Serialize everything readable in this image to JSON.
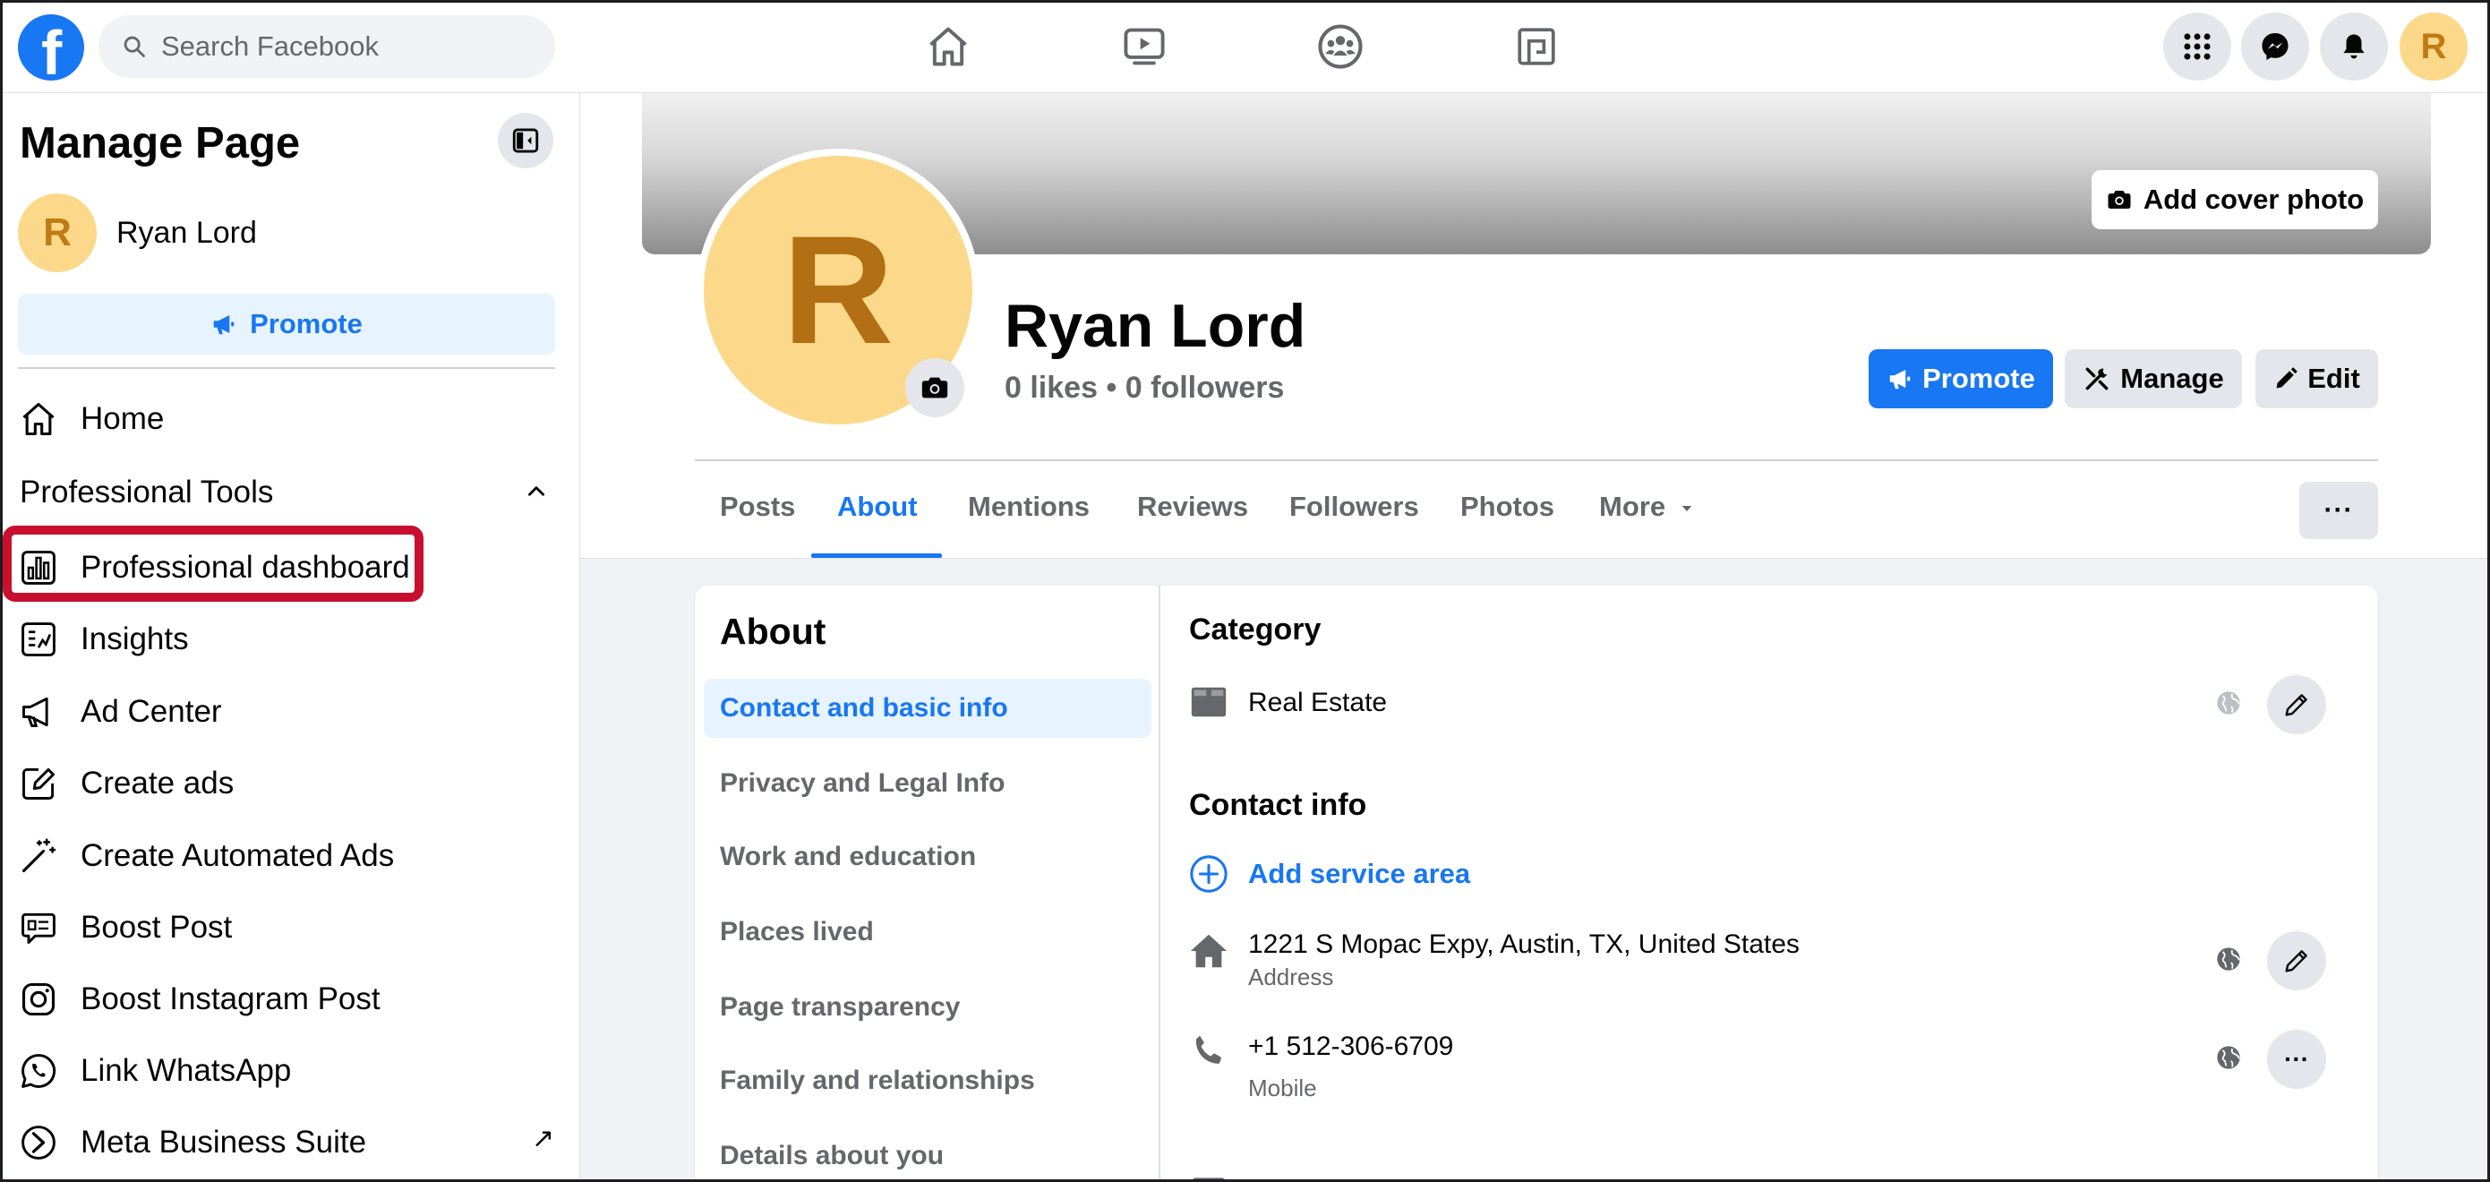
{
  "topbar": {
    "logo_letter": "f",
    "search_placeholder": "Search Facebook",
    "nav_icons": [
      "home-icon",
      "watch-icon",
      "groups-icon",
      "gaming-icon"
    ],
    "right_icons": [
      "menu-grid-icon",
      "messenger-icon",
      "notifications-icon"
    ],
    "avatar_letter": "R"
  },
  "sidebar": {
    "title": "Manage Page",
    "user_initial": "R",
    "user_name": "Ryan Lord",
    "promote_label": "Promote",
    "home_label": "Home",
    "section_label": "Professional Tools",
    "items": [
      {
        "label": "Professional dashboard",
        "icon": "dashboard-icon"
      },
      {
        "label": "Insights",
        "icon": "insights-icon"
      },
      {
        "label": "Ad Center",
        "icon": "megaphone-icon"
      },
      {
        "label": "Create ads",
        "icon": "edit-square-icon"
      },
      {
        "label": "Create Automated Ads",
        "icon": "magic-wand-icon"
      },
      {
        "label": "Boost Post",
        "icon": "boost-post-icon"
      },
      {
        "label": "Boost Instagram Post",
        "icon": "instagram-icon"
      },
      {
        "label": "Link WhatsApp",
        "icon": "whatsapp-icon"
      },
      {
        "label": "Meta Business Suite",
        "icon": "meta-business-icon"
      }
    ],
    "external_arrow": "↗"
  },
  "profile": {
    "add_cover_label": "Add cover photo",
    "initial": "R",
    "name": "Ryan Lord",
    "stats": "0 likes • 0 followers",
    "promote_label": "Promote",
    "manage_label": "Manage",
    "edit_label": "Edit",
    "tabs": [
      "Posts",
      "About",
      "Mentions",
      "Reviews",
      "Followers",
      "Photos",
      "More"
    ],
    "active_tab": "About",
    "more_dots": "···"
  },
  "about": {
    "title": "About",
    "nav": [
      "Contact and basic info",
      "Privacy and Legal Info",
      "Work and education",
      "Places lived",
      "Page transparency",
      "Family and relationships",
      "Details about you"
    ],
    "category_title": "Category",
    "category_value": "Real Estate",
    "contact_title": "Contact info",
    "add_service_area": "Add service area",
    "address": "1221 S Mopac Expy, Austin, TX, United States",
    "address_label": "Address",
    "phone": "+1 512-306-6709",
    "phone_label": "Mobile",
    "row_more": "···"
  },
  "colors": {
    "brand_blue": "#1877f2",
    "highlight_red": "#c8102e",
    "avatar_yellow": "#fcd98a"
  }
}
